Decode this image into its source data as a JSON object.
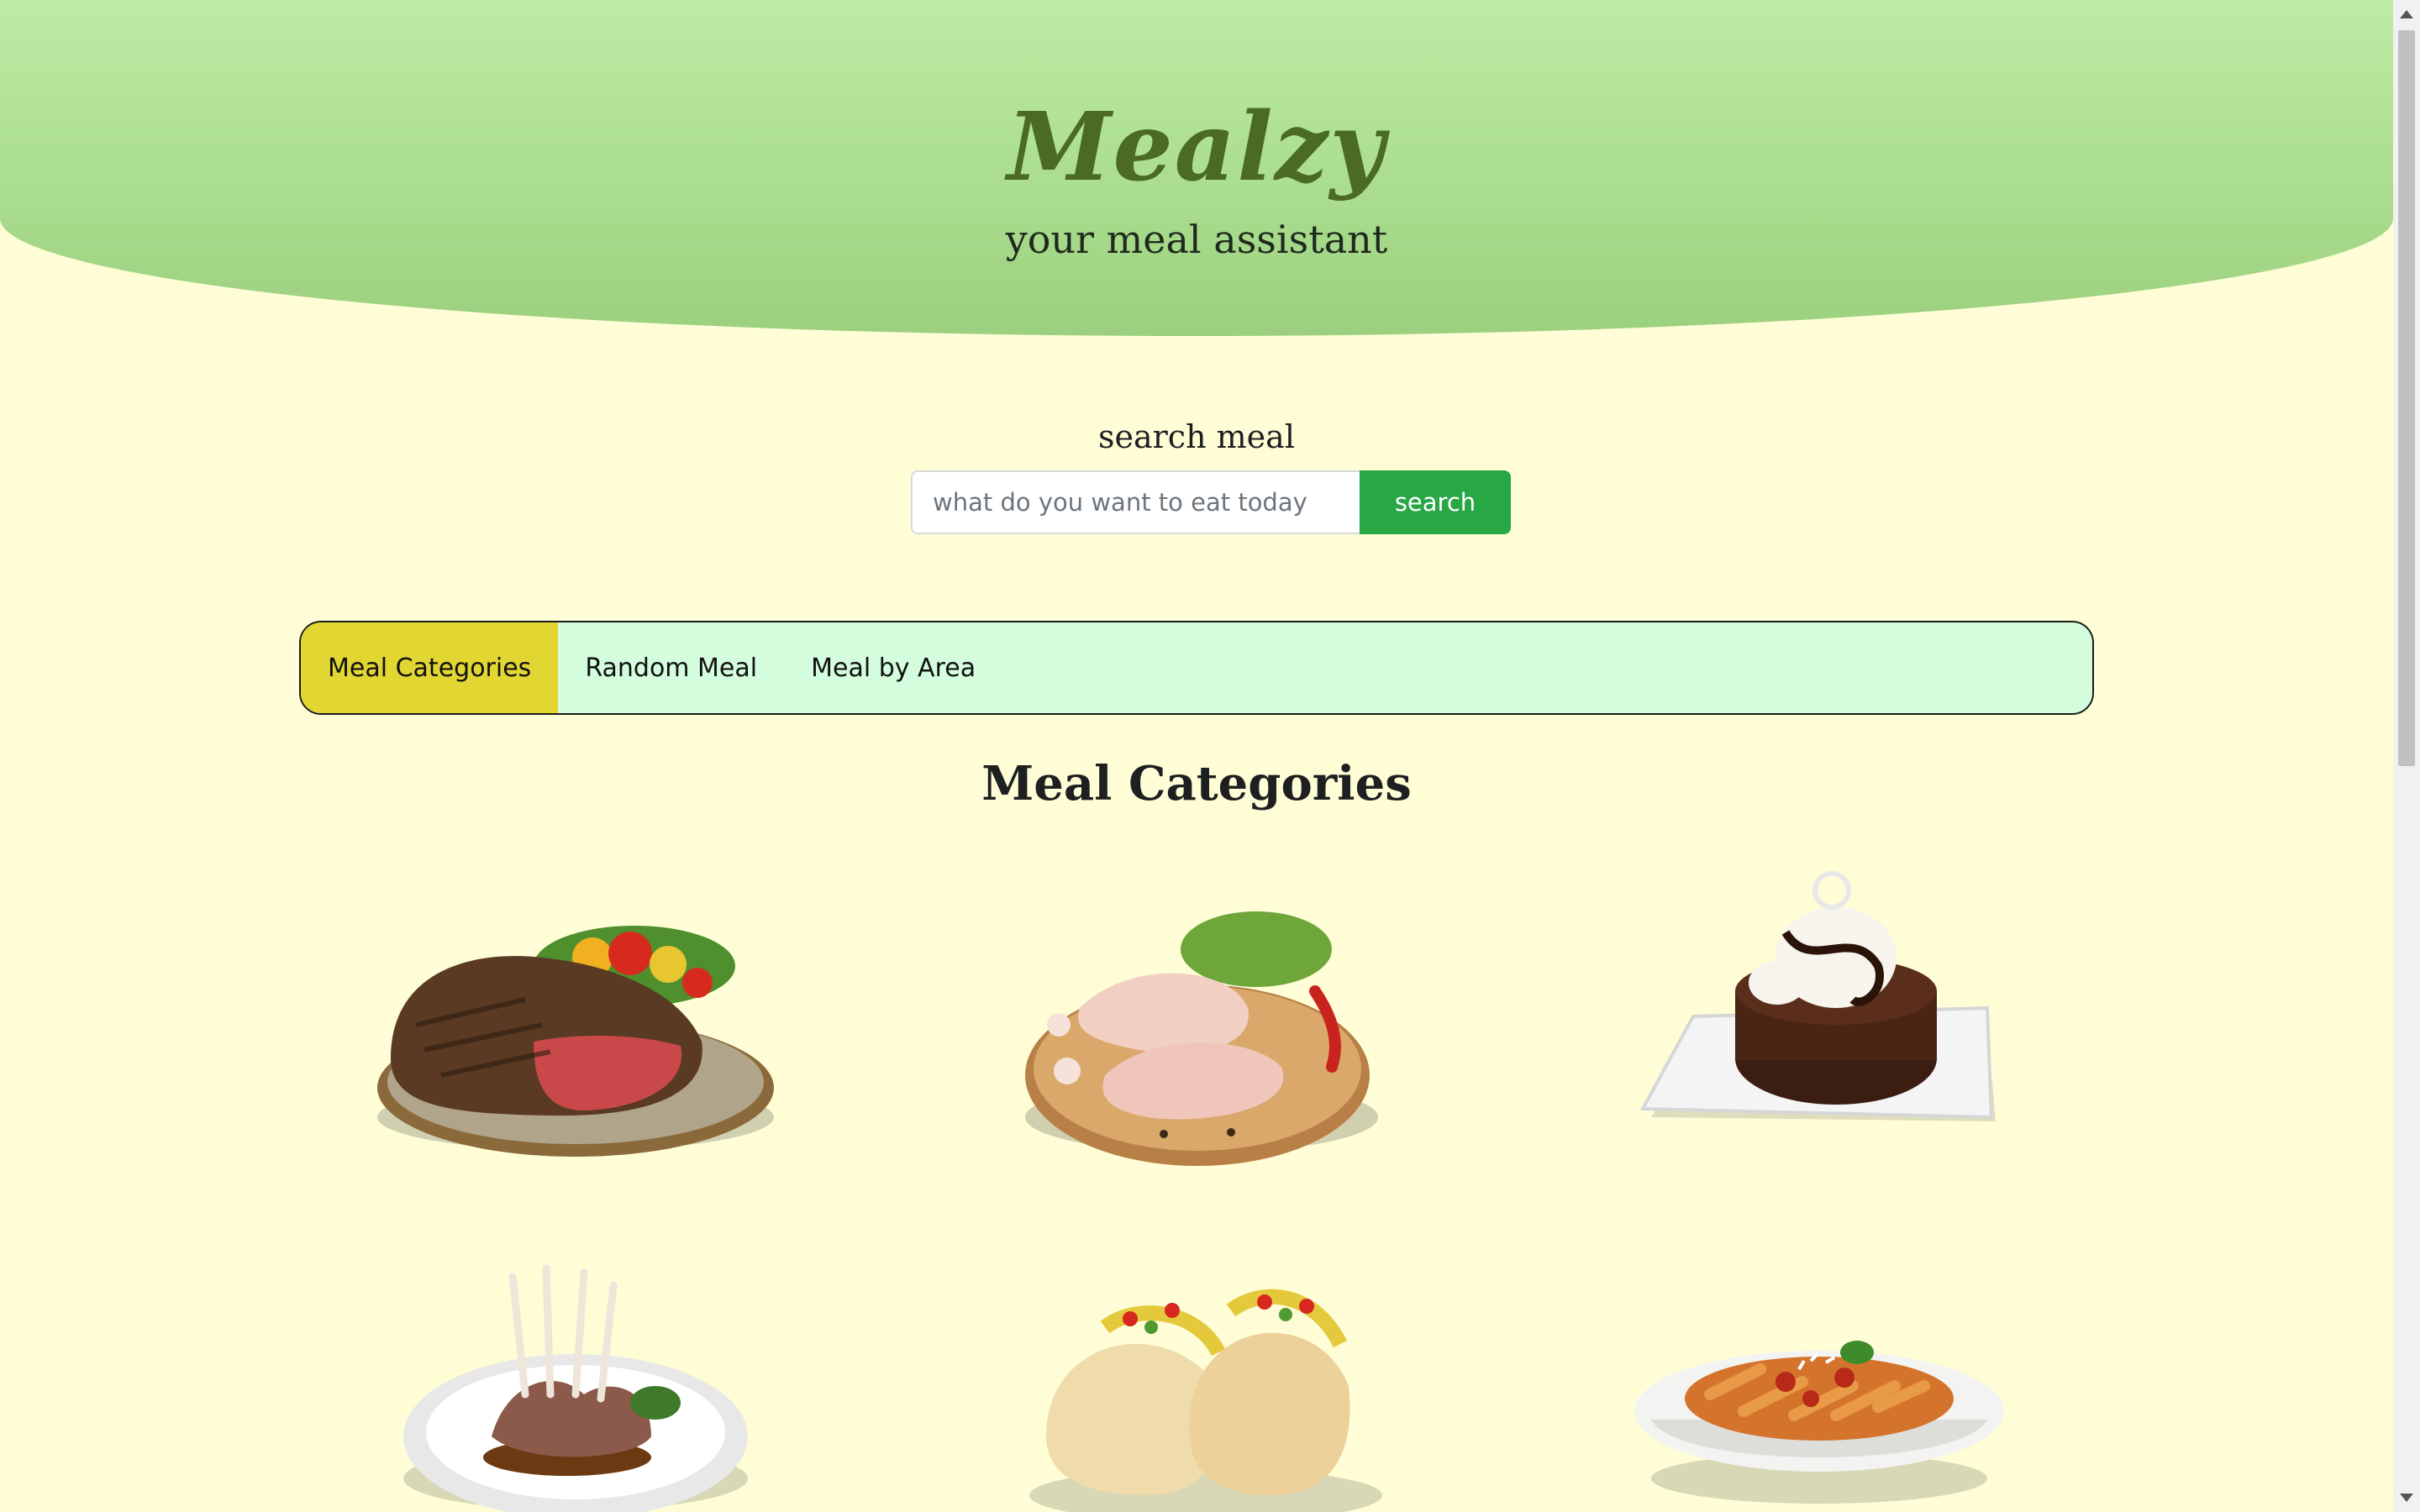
{
  "header": {
    "title": "Mealzy",
    "subtitle": "your meal assistant"
  },
  "search": {
    "label": "search meal",
    "placeholder": "what do you want to eat today",
    "button_label": "search"
  },
  "tabs": [
    {
      "label": "Meal Categories",
      "active": true
    },
    {
      "label": "Random Meal",
      "active": false
    },
    {
      "label": "Meal by Area",
      "active": false
    }
  ],
  "section": {
    "title": "Meal Categories"
  },
  "categories": [
    {
      "image": "beef-steak-plate-image"
    },
    {
      "image": "raw-chicken-legs-board-image"
    },
    {
      "image": "chocolate-dessert-plate-image"
    },
    {
      "image": "lamb-chops-plate-image"
    },
    {
      "image": "tacos-image"
    },
    {
      "image": "pasta-bowl-image"
    }
  ],
  "colors": {
    "background": "#fefdd6",
    "header": "#a9dc8c",
    "title": "#4a6a25",
    "search_button": "#28a745",
    "tabs_bar": "#d4fddd",
    "active_tab": "#e2d633"
  }
}
